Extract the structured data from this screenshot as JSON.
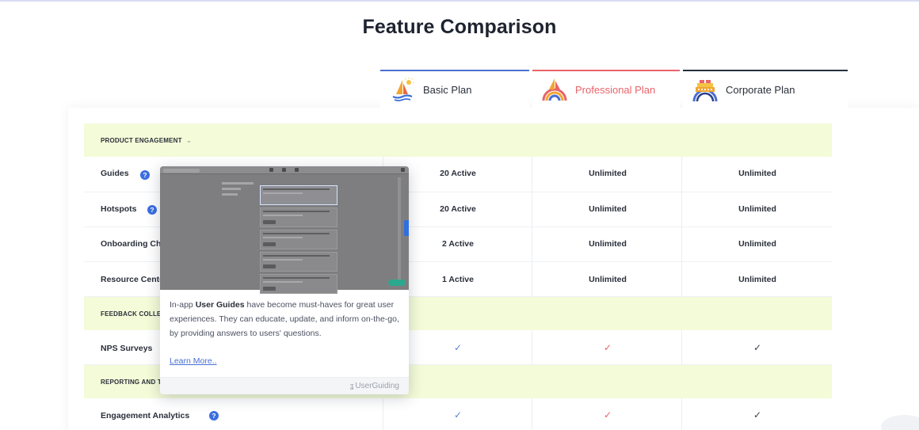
{
  "page": {
    "title": "Feature Comparison"
  },
  "plans": [
    {
      "name": "Basic Plan",
      "icon": "sailboat-sun-icon",
      "accent": "#4a6fd1"
    },
    {
      "name": "Professional Plan",
      "icon": "sailboat-rainbow-icon",
      "accent": "#e8636a"
    },
    {
      "name": "Corporate Plan",
      "icon": "cruise-ship-rainbow-icon",
      "accent": "#25303f"
    }
  ],
  "sections": [
    {
      "label": "PRODUCT ENGAGEMENT",
      "expanded": true,
      "rows": [
        {
          "name": "Guides",
          "values": [
            "20 Active",
            "Unlimited",
            "Unlimited"
          ]
        },
        {
          "name": "Hotspots",
          "values": [
            "20 Active",
            "Unlimited",
            "Unlimited"
          ]
        },
        {
          "name": "Onboarding Ch",
          "values": [
            "2 Active",
            "Unlimited",
            "Unlimited"
          ]
        },
        {
          "name": "Resource Cente",
          "values": [
            "1 Active",
            "Unlimited",
            "Unlimited"
          ]
        }
      ]
    },
    {
      "label": "FEEDBACK COLLE",
      "rows": [
        {
          "name": "NPS Surveys",
          "values": [
            "✓",
            "✓",
            "✓"
          ]
        }
      ]
    },
    {
      "label": "REPORTING AND T",
      "rows": [
        {
          "name": "Engagement Analytics",
          "values": [
            "✓",
            "✓",
            "✓"
          ]
        }
      ]
    }
  ],
  "tooltip": {
    "text_before": "In-app ",
    "text_bold": "User Guides",
    "text_after": " have become must-haves for great user experiences. They can educate, update, and inform on-the-go, by providing answers to users' questions.",
    "link": "Learn More..",
    "brand": "UserGuiding"
  },
  "colors": {
    "section_bg": "#f4fbd8",
    "help_icon": "#3b6ee0",
    "check_basic": "#5b7fd6",
    "check_pro": "#e8636a",
    "check_corp": "#39404d"
  }
}
